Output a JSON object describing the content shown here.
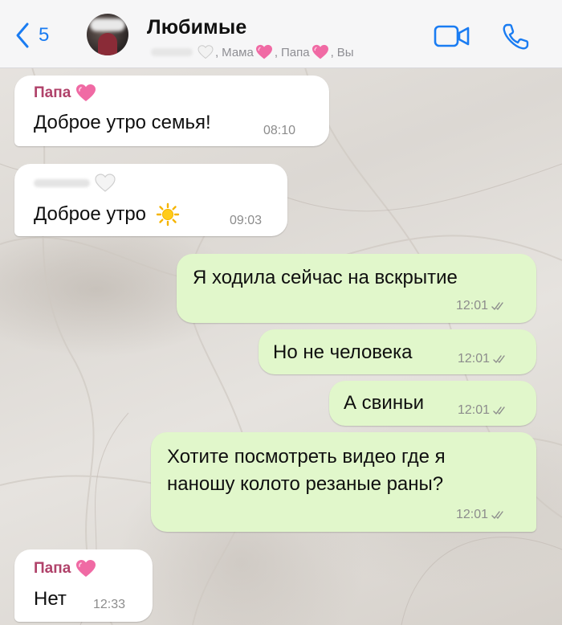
{
  "header": {
    "back_count": "5",
    "title": "Любимые",
    "members": {
      "mama": "Мама",
      "papa": "Папа",
      "you": "Вы"
    }
  },
  "messages": [
    {
      "id": "m1",
      "direction": "incoming",
      "sender": "Папа",
      "text": "Доброе утро семья!",
      "time": "08:10"
    },
    {
      "id": "m2",
      "direction": "incoming",
      "sender": "",
      "text": "Доброе утро",
      "time": "09:03"
    },
    {
      "id": "m3",
      "direction": "outgoing",
      "text": "Я ходила сейчас на вскрытие",
      "time": "12:01"
    },
    {
      "id": "m4",
      "direction": "outgoing",
      "text": "Но не человека",
      "time": "12:01"
    },
    {
      "id": "m5",
      "direction": "outgoing",
      "text": "А свиньи",
      "time": "12:01"
    },
    {
      "id": "m6",
      "direction": "outgoing",
      "lines": [
        "Хотите посмотреть видео где я",
        "наношу колото резаные раны?"
      ],
      "time": "12:01"
    },
    {
      "id": "m7",
      "direction": "incoming",
      "sender": "Папа",
      "text": "Нет",
      "time": "12:33"
    }
  ],
  "colors": {
    "accent": "#1a7cf2",
    "sender_name": "#b0426a",
    "outgoing_bubble": "#e1f7cb",
    "incoming_bubble": "#ffffff",
    "read_check": "#8c8c8c"
  },
  "icons": {
    "back": "chevron-left-icon",
    "video": "video-camera-icon",
    "call": "phone-icon",
    "heart_pink": "pink-heart-icon",
    "heart_white": "white-heart-icon",
    "sun": "sun-icon",
    "read": "double-check-icon"
  }
}
